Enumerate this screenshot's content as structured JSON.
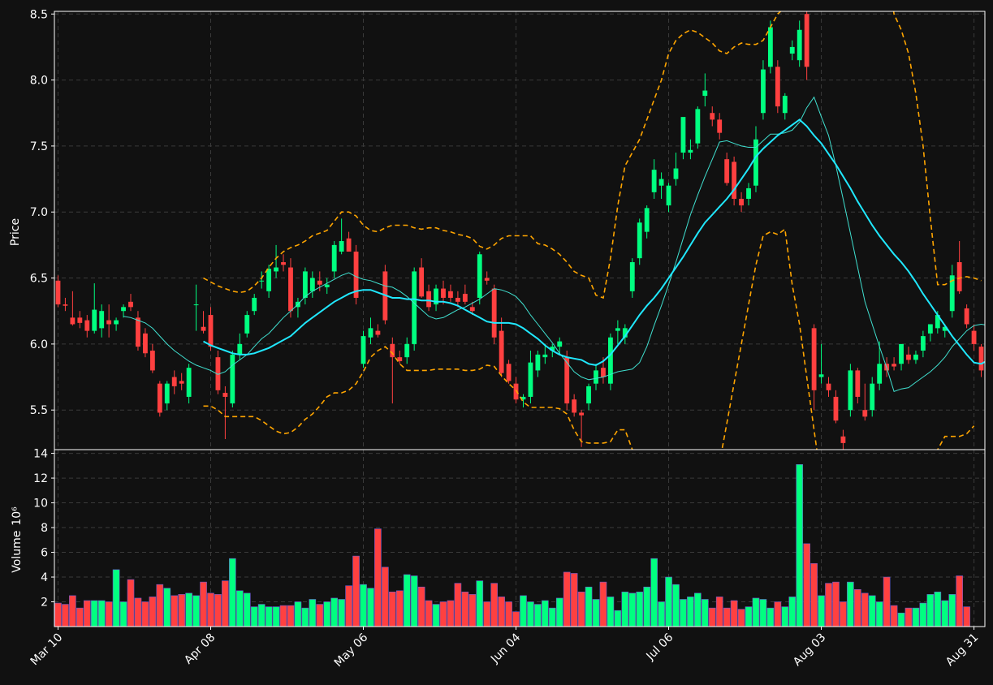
{
  "colors": {
    "background": "#111111",
    "up": "#00ff80",
    "down": "#ff4040",
    "grid": "#3a3a3a",
    "ma_fast": "#40e0d0",
    "ma_slow": "#20e8ff",
    "bands": "#ffa500",
    "text": "#ffffff"
  },
  "chart_data": {
    "type": "candlestick",
    "grid": true,
    "price_panel": {
      "ylabel": "Price",
      "ylim": [
        5.2,
        8.52
      ],
      "yticks": [
        5.5,
        6.0,
        6.5,
        7.0,
        7.5,
        8.0,
        8.5
      ]
    },
    "volume_panel": {
      "ylabel": "Volume",
      "yexponent": "10⁶",
      "ylim": [
        0,
        14.3
      ],
      "yticks": [
        2,
        4,
        6,
        8,
        10,
        12,
        14
      ]
    },
    "xticks": [
      {
        "label": "Mar 10",
        "i": 0
      },
      {
        "label": "Apr 08",
        "i": 21
      },
      {
        "label": "May 06",
        "i": 42
      },
      {
        "label": "Jun 04",
        "i": 63
      },
      {
        "label": "Jul 06",
        "i": 84
      },
      {
        "label": "Aug 03",
        "i": 105
      },
      {
        "label": "Aug 31",
        "i": 126
      }
    ],
    "ohlc": [
      [
        6.48,
        6.52,
        6.28,
        6.3
      ],
      [
        6.3,
        6.35,
        6.25,
        6.29
      ],
      [
        6.2,
        6.4,
        6.14,
        6.15
      ],
      [
        6.2,
        6.25,
        6.12,
        6.16
      ],
      [
        6.18,
        6.22,
        6.05,
        6.1
      ],
      [
        6.1,
        6.46,
        6.08,
        6.26
      ],
      [
        6.12,
        6.3,
        6.05,
        6.25
      ],
      [
        6.18,
        6.3,
        6.05,
        6.15
      ],
      [
        6.15,
        6.2,
        6.1,
        6.18
      ],
      [
        6.25,
        6.3,
        6.2,
        6.28
      ],
      [
        6.32,
        6.38,
        6.25,
        6.28
      ],
      [
        6.2,
        6.25,
        5.95,
        5.98
      ],
      [
        6.08,
        6.12,
        5.9,
        5.93
      ],
      [
        5.95,
        6.0,
        5.78,
        5.8
      ],
      [
        5.7,
        5.72,
        5.45,
        5.48
      ],
      [
        5.55,
        5.72,
        5.5,
        5.7
      ],
      [
        5.75,
        5.8,
        5.62,
        5.68
      ],
      [
        5.72,
        5.78,
        5.65,
        5.7
      ],
      [
        5.6,
        5.85,
        5.55,
        5.82
      ],
      [
        6.3,
        6.45,
        6.1,
        6.3
      ],
      [
        6.13,
        6.25,
        6.08,
        6.1
      ],
      [
        6.22,
        6.28,
        5.95,
        5.98
      ],
      [
        5.9,
        5.95,
        5.62,
        5.65
      ],
      [
        5.63,
        5.68,
        5.28,
        5.6
      ],
      [
        5.55,
        5.95,
        5.52,
        5.92
      ],
      [
        5.92,
        6.08,
        5.88,
        6.0
      ],
      [
        6.08,
        6.25,
        6.05,
        6.22
      ],
      [
        6.25,
        6.38,
        6.22,
        6.35
      ],
      [
        6.48,
        6.55,
        6.42,
        6.48
      ],
      [
        6.4,
        6.6,
        6.35,
        6.57
      ],
      [
        6.55,
        6.75,
        6.5,
        6.58
      ],
      [
        6.62,
        6.68,
        6.55,
        6.6
      ],
      [
        6.58,
        6.65,
        6.2,
        6.25
      ],
      [
        6.28,
        6.35,
        6.2,
        6.32
      ],
      [
        6.35,
        6.58,
        6.3,
        6.55
      ],
      [
        6.4,
        6.55,
        6.35,
        6.5
      ],
      [
        6.48,
        6.55,
        6.4,
        6.45
      ],
      [
        6.43,
        6.5,
        6.38,
        6.45
      ],
      [
        6.55,
        6.78,
        6.5,
        6.75
      ],
      [
        6.7,
        6.95,
        6.68,
        6.78
      ],
      [
        6.8,
        6.85,
        6.7,
        6.7
      ],
      [
        6.7,
        6.75,
        6.3,
        6.35
      ],
      [
        5.85,
        6.1,
        5.82,
        6.06
      ],
      [
        6.05,
        6.2,
        6.0,
        6.12
      ],
      [
        6.1,
        6.15,
        6.05,
        6.07
      ],
      [
        6.55,
        6.6,
        6.15,
        6.18
      ],
      [
        6.0,
        6.05,
        5.55,
        5.9
      ],
      [
        5.9,
        5.95,
        5.85,
        5.87
      ],
      [
        5.9,
        6.05,
        5.85,
        6.0
      ],
      [
        6.0,
        6.58,
        5.95,
        6.55
      ],
      [
        6.58,
        6.65,
        6.35,
        6.36
      ],
      [
        6.4,
        6.45,
        6.25,
        6.28
      ],
      [
        6.3,
        6.45,
        6.25,
        6.42
      ],
      [
        6.42,
        6.48,
        6.3,
        6.35
      ],
      [
        6.4,
        6.45,
        6.32,
        6.35
      ],
      [
        6.35,
        6.4,
        6.28,
        6.32
      ],
      [
        6.38,
        6.45,
        6.3,
        6.32
      ],
      [
        6.28,
        6.32,
        6.22,
        6.25
      ],
      [
        6.35,
        6.7,
        6.3,
        6.68
      ],
      [
        6.5,
        6.55,
        6.45,
        6.48
      ],
      [
        6.42,
        6.45,
        6.0,
        6.05
      ],
      [
        6.1,
        6.2,
        5.75,
        5.78
      ],
      [
        5.85,
        5.88,
        5.7,
        5.72
      ],
      [
        5.7,
        5.75,
        5.55,
        5.58
      ],
      [
        5.58,
        5.62,
        5.52,
        5.6
      ],
      [
        5.6,
        5.95,
        5.55,
        5.86
      ],
      [
        5.8,
        5.95,
        5.75,
        5.92
      ],
      [
        5.9,
        6.0,
        5.85,
        5.92
      ],
      [
        5.95,
        6.0,
        5.9,
        5.98
      ],
      [
        5.98,
        6.05,
        5.92,
        6.02
      ],
      [
        5.9,
        5.95,
        5.5,
        5.55
      ],
      [
        5.58,
        5.62,
        5.45,
        5.48
      ],
      [
        5.48,
        5.5,
        5.22,
        5.46
      ],
      [
        5.55,
        5.7,
        5.5,
        5.68
      ],
      [
        5.7,
        5.85,
        5.65,
        5.8
      ],
      [
        5.82,
        5.9,
        5.7,
        5.75
      ],
      [
        5.7,
        6.08,
        5.65,
        6.05
      ],
      [
        6.1,
        6.18,
        6.0,
        6.12
      ],
      [
        6.05,
        6.15,
        6.0,
        6.12
      ],
      [
        6.4,
        6.65,
        6.35,
        6.62
      ],
      [
        6.65,
        6.95,
        6.6,
        6.92
      ],
      [
        6.85,
        7.05,
        6.8,
        7.03
      ],
      [
        7.15,
        7.4,
        7.1,
        7.32
      ],
      [
        7.2,
        7.3,
        7.1,
        7.25
      ],
      [
        7.05,
        7.22,
        7.0,
        7.2
      ],
      [
        7.25,
        7.45,
        7.2,
        7.33
      ],
      [
        7.45,
        7.7,
        7.4,
        7.72
      ],
      [
        7.45,
        7.55,
        7.4,
        7.47
      ],
      [
        7.52,
        7.8,
        7.48,
        7.78
      ],
      [
        7.88,
        8.05,
        7.8,
        7.92
      ],
      [
        7.75,
        7.8,
        7.65,
        7.7
      ],
      [
        7.7,
        7.75,
        7.55,
        7.6
      ],
      [
        7.4,
        7.45,
        7.2,
        7.22
      ],
      [
        7.38,
        7.42,
        7.05,
        7.1
      ],
      [
        7.1,
        7.15,
        7.0,
        7.05
      ],
      [
        7.1,
        7.22,
        7.05,
        7.18
      ],
      [
        7.2,
        7.65,
        7.15,
        7.55
      ],
      [
        7.75,
        8.15,
        7.7,
        8.08
      ],
      [
        8.1,
        8.45,
        8.05,
        8.4
      ],
      [
        8.1,
        8.15,
        7.75,
        7.8
      ],
      [
        7.75,
        7.9,
        7.7,
        7.88
      ],
      [
        8.2,
        8.3,
        8.15,
        8.25
      ],
      [
        8.15,
        8.45,
        8.1,
        8.38
      ],
      [
        8.5,
        8.65,
        8.0,
        8.1
      ],
      [
        6.12,
        6.15,
        5.5,
        5.65
      ],
      [
        5.75,
        6.0,
        5.7,
        5.77
      ],
      [
        5.7,
        5.75,
        5.6,
        5.65
      ],
      [
        5.6,
        5.65,
        5.4,
        5.42
      ],
      [
        5.3,
        5.35,
        5.2,
        5.25
      ],
      [
        5.5,
        5.85,
        5.45,
        5.8
      ],
      [
        5.8,
        5.82,
        5.55,
        5.6
      ],
      [
        5.5,
        5.7,
        5.42,
        5.45
      ],
      [
        5.5,
        5.75,
        5.45,
        5.7
      ],
      [
        5.7,
        6.02,
        5.65,
        5.85
      ],
      [
        5.85,
        5.9,
        5.75,
        5.8
      ],
      [
        5.85,
        5.9,
        5.8,
        5.83
      ],
      [
        5.85,
        6.0,
        5.8,
        6.0
      ],
      [
        5.92,
        5.98,
        5.85,
        5.88
      ],
      [
        5.88,
        5.95,
        5.85,
        5.92
      ],
      [
        5.95,
        6.1,
        5.9,
        6.06
      ],
      [
        6.08,
        6.15,
        6.02,
        6.15
      ],
      [
        6.12,
        6.25,
        6.08,
        6.22
      ],
      [
        6.1,
        6.15,
        6.05,
        6.13
      ],
      [
        6.25,
        6.6,
        6.2,
        6.52
      ],
      [
        6.62,
        6.78,
        6.38,
        6.4
      ],
      [
        6.27,
        6.3,
        6.12,
        6.15
      ],
      [
        6.1,
        6.15,
        5.95,
        6.0
      ],
      [
        5.98,
        6.0,
        5.75,
        5.8
      ]
    ],
    "volume": [
      1.9,
      1.8,
      2.5,
      1.5,
      2.1,
      2.1,
      2.1,
      2.0,
      4.6,
      2.0,
      3.8,
      2.3,
      2.0,
      2.4,
      3.4,
      3.1,
      2.5,
      2.6,
      2.7,
      2.5,
      3.6,
      2.7,
      2.6,
      3.7,
      5.5,
      2.9,
      2.7,
      1.6,
      1.8,
      1.6,
      1.6,
      1.7,
      1.7,
      2.0,
      1.5,
      2.2,
      1.8,
      2.0,
      2.3,
      2.2,
      3.3,
      5.7,
      3.4,
      3.1,
      7.9,
      4.8,
      2.8,
      2.9,
      4.2,
      4.1,
      3.2,
      2.1,
      1.8,
      2.0,
      2.1,
      3.5,
      2.8,
      2.6,
      3.7,
      2.0,
      3.5,
      2.4,
      2.0,
      1.2,
      2.5,
      2.0,
      1.8,
      2.1,
      1.5,
      2.3,
      4.4,
      4.3,
      2.8,
      3.2,
      2.2,
      3.6,
      2.4,
      1.3,
      2.8,
      2.7,
      2.8,
      3.2,
      5.5,
      2.0,
      4.0,
      3.4,
      2.2,
      2.4,
      2.7,
      2.2,
      1.5,
      2.4,
      1.5,
      2.1,
      1.4,
      1.6,
      2.3,
      2.2,
      1.5,
      2.0,
      1.6,
      2.4,
      13.1,
      6.7,
      5.1,
      2.5,
      3.5,
      3.6,
      2.0,
      3.6,
      3.0,
      2.7,
      2.5,
      2.0,
      4.0,
      1.7,
      1.1,
      1.5,
      1.5,
      1.9,
      2.6,
      2.8,
      2.1,
      2.6,
      4.1,
      1.6
    ],
    "ma_fast": [
      null,
      null,
      null,
      null,
      null,
      null,
      null,
      null,
      null,
      6.21,
      6.2,
      6.18,
      6.16,
      6.12,
      6.06,
      6.0,
      5.95,
      5.91,
      5.87,
      5.84,
      5.82,
      5.8,
      5.77,
      5.79,
      5.84,
      5.88,
      5.92,
      5.98,
      6.04,
      6.08,
      6.14,
      6.2,
      6.25,
      6.3,
      6.36,
      6.4,
      6.43,
      6.46,
      6.49,
      6.52,
      6.54,
      6.51,
      6.49,
      6.48,
      6.46,
      6.44,
      6.43,
      6.4,
      6.36,
      6.31,
      6.26,
      6.21,
      6.19,
      6.2,
      6.23,
      6.26,
      6.28,
      6.31,
      6.34,
      6.38,
      6.42,
      6.41,
      6.39,
      6.36,
      6.3,
      6.22,
      6.15,
      6.08,
      6.01,
      5.93,
      5.86,
      5.79,
      5.75,
      5.73,
      5.74,
      5.75,
      5.77,
      5.79,
      5.8,
      5.81,
      5.86,
      5.98,
      6.14,
      6.29,
      6.45,
      6.62,
      6.8,
      6.98,
      7.13,
      7.27,
      7.4,
      7.53,
      7.54,
      7.52,
      7.5,
      7.49,
      7.49,
      7.54,
      7.59,
      7.59,
      7.6,
      7.62,
      7.68,
      7.79,
      7.87,
      7.72,
      7.58,
      7.35,
      7.1,
      6.84,
      6.58,
      6.32,
      6.15,
      5.98,
      5.82,
      5.64,
      5.66,
      5.67,
      5.71,
      5.75,
      5.79,
      5.84,
      5.9,
      5.98,
      6.04,
      6.1,
      6.14,
      6.15,
      6.14
    ],
    "ma_slow": [
      null,
      null,
      null,
      null,
      null,
      null,
      null,
      null,
      null,
      null,
      null,
      null,
      null,
      null,
      null,
      null,
      null,
      null,
      null,
      null,
      6.02,
      5.99,
      5.97,
      5.95,
      5.93,
      5.92,
      5.92,
      5.93,
      5.95,
      5.97,
      6.0,
      6.03,
      6.06,
      6.11,
      6.16,
      6.2,
      6.24,
      6.28,
      6.32,
      6.35,
      6.38,
      6.4,
      6.41,
      6.41,
      6.39,
      6.37,
      6.35,
      6.35,
      6.34,
      6.34,
      6.33,
      6.33,
      6.32,
      6.32,
      6.31,
      6.29,
      6.26,
      6.23,
      6.2,
      6.17,
      6.16,
      6.16,
      6.16,
      6.15,
      6.12,
      6.08,
      6.04,
      5.99,
      5.95,
      5.92,
      5.9,
      5.89,
      5.88,
      5.85,
      5.84,
      5.87,
      5.92,
      5.99,
      6.06,
      6.14,
      6.22,
      6.29,
      6.35,
      6.42,
      6.5,
      6.58,
      6.66,
      6.75,
      6.84,
      6.92,
      6.98,
      7.04,
      7.1,
      7.17,
      7.25,
      7.33,
      7.42,
      7.48,
      7.53,
      7.58,
      7.62,
      7.66,
      7.7,
      7.65,
      7.58,
      7.52,
      7.44,
      7.36,
      7.27,
      7.18,
      7.08,
      6.99,
      6.9,
      6.82,
      6.75,
      6.68,
      6.62,
      6.55,
      6.47,
      6.38,
      6.3,
      6.22,
      6.14,
      6.06,
      5.99,
      5.92,
      5.86,
      5.85,
      5.88,
      5.9,
      5.92,
      5.94
    ],
    "band_upper": [
      null,
      null,
      null,
      null,
      null,
      null,
      null,
      null,
      null,
      null,
      null,
      null,
      null,
      null,
      null,
      null,
      null,
      null,
      null,
      null,
      6.5,
      6.47,
      6.44,
      6.42,
      6.4,
      6.39,
      6.4,
      6.44,
      6.5,
      6.58,
      6.65,
      6.7,
      6.73,
      6.75,
      6.78,
      6.82,
      6.84,
      6.86,
      6.93,
      7.0,
      7.0,
      6.97,
      6.9,
      6.86,
      6.85,
      6.88,
      6.9,
      6.9,
      6.9,
      6.88,
      6.87,
      6.88,
      6.88,
      6.86,
      6.85,
      6.83,
      6.82,
      6.8,
      6.74,
      6.72,
      6.75,
      6.8,
      6.82,
      6.82,
      6.82,
      6.82,
      6.76,
      6.75,
      6.72,
      6.68,
      6.62,
      6.55,
      6.52,
      6.5,
      6.37,
      6.35,
      6.65,
      7.05,
      7.35,
      7.45,
      7.55,
      7.7,
      7.85,
      8.0,
      8.2,
      8.3,
      8.35,
      8.38,
      8.36,
      8.32,
      8.28,
      8.22,
      8.2,
      8.25,
      8.28,
      8.27,
      8.27,
      8.3,
      8.4,
      8.5,
      8.55,
      8.55,
      8.6,
      8.65,
      8.7,
      8.75,
      8.8,
      8.85,
      8.9,
      9.0,
      9.1,
      9.15,
      9.2,
      9.1,
      8.9,
      8.5,
      8.38,
      8.2,
      7.9,
      7.5,
      6.95,
      6.45,
      6.45,
      6.48,
      6.5,
      6.51,
      6.5,
      6.48
    ],
    "band_lower": [
      null,
      null,
      null,
      null,
      null,
      null,
      null,
      null,
      null,
      null,
      null,
      null,
      null,
      null,
      null,
      null,
      null,
      null,
      null,
      null,
      5.53,
      5.53,
      5.5,
      5.45,
      5.45,
      5.45,
      5.45,
      5.45,
      5.42,
      5.38,
      5.34,
      5.32,
      5.33,
      5.37,
      5.43,
      5.47,
      5.53,
      5.6,
      5.63,
      5.63,
      5.65,
      5.7,
      5.79,
      5.9,
      5.95,
      5.98,
      5.93,
      5.85,
      5.8,
      5.8,
      5.8,
      5.8,
      5.81,
      5.81,
      5.81,
      5.81,
      5.8,
      5.8,
      5.81,
      5.84,
      5.83,
      5.76,
      5.7,
      5.65,
      5.56,
      5.52,
      5.52,
      5.52,
      5.52,
      5.51,
      5.47,
      5.35,
      5.26,
      5.25,
      5.25,
      5.25,
      5.26,
      5.35,
      5.35,
      5.2,
      5.05,
      4.9,
      4.75,
      4.6,
      4.5,
      4.4,
      4.35,
      4.32,
      4.35,
      4.5,
      4.8,
      5.1,
      5.4,
      5.7,
      6.0,
      6.3,
      6.6,
      6.82,
      6.85,
      6.83,
      6.87,
      6.45,
      6.15,
      5.75,
      5.35,
      4.95,
      4.6,
      4.3,
      4.05,
      3.85,
      3.7,
      3.6,
      3.6,
      3.7,
      3.9,
      4.15,
      4.4,
      4.65,
      4.9,
      5.05,
      5.1,
      5.2,
      5.3,
      5.3,
      5.3,
      5.32,
      5.38
    ]
  }
}
